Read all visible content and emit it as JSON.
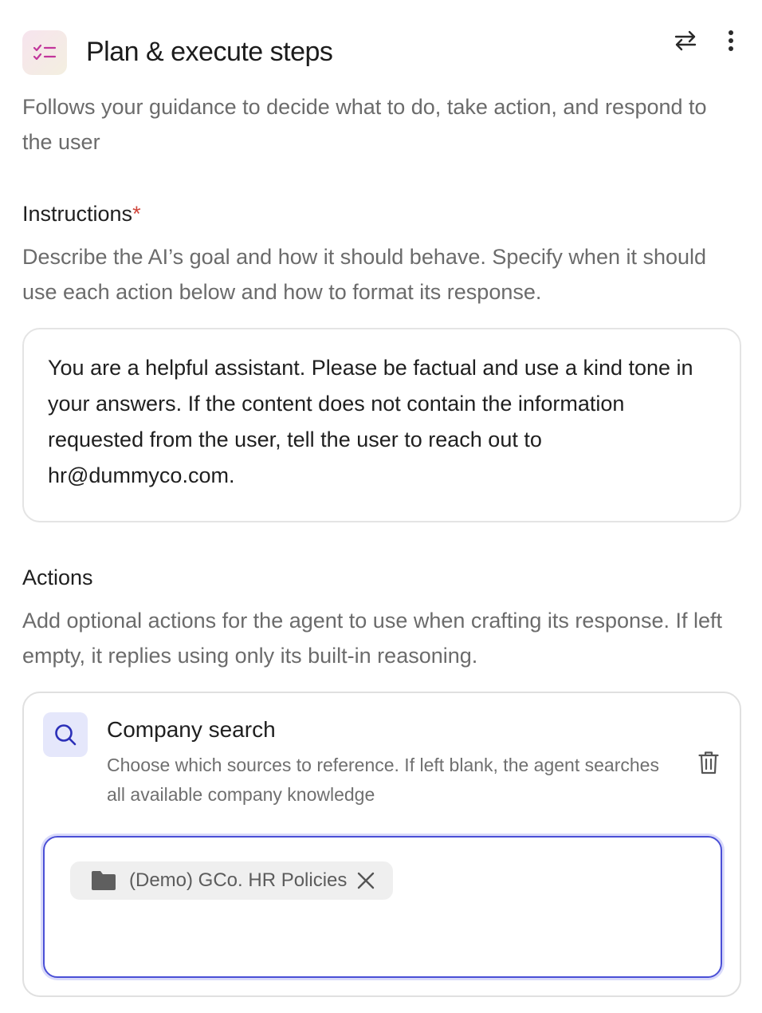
{
  "header": {
    "title": "Plan & execute steps",
    "subtitle": "Follows your guidance to decide what to do, take action, and respond to the user",
    "icon": "checklist-icon",
    "actions": {
      "swap_icon": "swap-arrows-icon",
      "more_icon": "more-vertical-icon"
    }
  },
  "instructions": {
    "label": "Instructions",
    "required_mark": "*",
    "description": "Describe the AI’s goal and how it should behave. Specify when it should use each action below and how to format its response.",
    "value": "You are a helpful assistant. Please be factual and use a kind tone in your answers.  If the content does not contain the information requested from the user, tell the user to reach out to hr@dummyco.com."
  },
  "actions": {
    "label": "Actions",
    "description": "Add optional actions for the agent to use when crafting its response. If left empty, it replies using only its built-in reasoning.",
    "items": [
      {
        "title": "Company search",
        "description": "Choose which sources to reference. If left blank, the agent searches all available company knowledge",
        "icon": "search-icon",
        "sources": [
          {
            "label": "(Demo) GCo. HR Policies",
            "icon": "folder-icon"
          }
        ]
      }
    ]
  },
  "colors": {
    "accent": "#4a4fd6",
    "required": "#d0453a",
    "icon_magenta": "#c2369b"
  }
}
